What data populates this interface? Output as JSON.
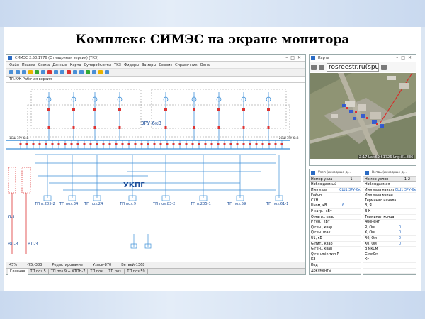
{
  "slide": {
    "title": "Комплекс СИМЭС на экране монитора"
  },
  "main_window": {
    "title": "СИМЭС 2.50.1776 (Отладочная версия) [ТКЗ]",
    "menu": [
      "Файл",
      "Правка",
      "Схема",
      "Данные",
      "Карта",
      "Суперобъекты",
      "ТКЗ",
      "Фидеры",
      "Замеры",
      "Сервис",
      "Справочник",
      "Окна"
    ],
    "doc_tab": "ТП.КЖ Рабочая версия",
    "status": [
      "45%",
      "-75;-383",
      "Редактирование",
      "Узлов-870",
      "Ветвей-1368"
    ],
    "page_tabs": [
      "Главная",
      "ТП поз.5",
      "ТП поз.9 + КТПН-7",
      "ТП поз.",
      "ТП поз.",
      "ТП поз.59"
    ],
    "diagram": {
      "bus_label_top": "ЗРУ-6кВ",
      "bus_left_label": "1СШ ЗРУ-6кВ",
      "bus_right_label": "2СШ ЗРУ-6кВ",
      "ukpg_label": "УКПГ",
      "left_labels": [
        "Л-1",
        "ВЛ-3",
        "ВЛ-3"
      ],
      "substations": [
        "ТП п.205-2",
        "ТП поз.34",
        "ТП поз.24",
        "ТП поз.9",
        "ТП поз.83-2",
        "ТП п.205-1",
        "ТП поз.59",
        "ТП поз.61-1"
      ]
    }
  },
  "map_window": {
    "title": "Карта",
    "url": "rosreestr.ru(sputnik",
    "coords": "Z:17 Lat:69.61726 Lng:81.836"
  },
  "props_left": {
    "title": "Узел (исходные д...",
    "col_header": "Номер узла",
    "col_value": "1",
    "rows": [
      [
        "Наблюдаемый",
        ""
      ],
      [
        "Имя узла",
        "СШ1 ЗРУ-6кВ"
      ],
      [
        "Район",
        ""
      ],
      [
        "СХН",
        ""
      ],
      [
        "Uном, кВ",
        "6"
      ],
      [
        "P нагр., кВт",
        ""
      ],
      [
        "Q нагр., квар",
        ""
      ],
      [
        "P ген., кВт",
        ""
      ],
      [
        "Q ген., квар",
        ""
      ],
      [
        "Q ген. max",
        ""
      ],
      [
        "U1, кВ",
        ""
      ],
      [
        "G пит., квар",
        ""
      ],
      [
        "G ген., квар",
        ""
      ],
      [
        "Q ген.min тип Р",
        ""
      ],
      [
        "КЗ",
        ""
      ],
      [
        "Код",
        ""
      ],
      [
        "Документы",
        ""
      ]
    ]
  },
  "props_right": {
    "title": "Ветвь (исходные д...",
    "col_header": "Номер узлов",
    "col_value": "1-2",
    "rows": [
      [
        "Наблюдаемая",
        ""
      ],
      [
        "Имя узла начала",
        "СШ1 ЗРУ-6кВ"
      ],
      [
        "Имя узла конца",
        ""
      ],
      [
        "Терминал начала",
        ""
      ],
      [
        "В, Я",
        ""
      ],
      [
        "В К",
        ""
      ],
      [
        "Терминал конца",
        ""
      ],
      [
        "Абонент",
        ""
      ],
      [
        "R, Ом",
        "0"
      ],
      [
        "X, Ом",
        "0"
      ],
      [
        "R0, Ом",
        "0"
      ],
      [
        "X0, Ом",
        "0"
      ],
      [
        "B мкСм",
        ""
      ],
      [
        "G мкСм",
        ""
      ],
      [
        "Кт",
        ""
      ],
      [
        "",
        ""
      ],
      [
        "",
        ""
      ]
    ]
  },
  "colors": {
    "accent": "#2a6bc4",
    "bus": "#3d8fd8",
    "breaker": "#d33333",
    "dashed_frame": "#888888"
  }
}
